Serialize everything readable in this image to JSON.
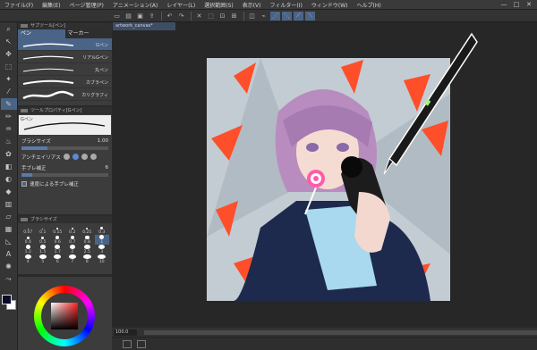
{
  "menu": {
    "items": [
      "ファイル(F)",
      "編集(E)",
      "ページ管理(P)",
      "アニメーション(A)",
      "レイヤー(L)",
      "選択範囲(S)",
      "表示(V)",
      "フィルター(I)",
      "ウィンドウ(W)",
      "ヘルプ(H)"
    ],
    "minimize": "—",
    "maximize": "□",
    "close": "✕"
  },
  "subtool": {
    "header": "サブツール[ペン]",
    "tabs": [
      "ペン",
      "マーカー"
    ],
    "brushes": [
      "Gペン",
      "リアルGペン",
      "丸ペン",
      "カブラペン",
      "カリグラフィ"
    ]
  },
  "toolprop": {
    "header": "ツールプロパティ[Gペン]",
    "brush_name": "Gペン",
    "size_label": "ブラシサイズ",
    "size_value": "1.00",
    "aa_label": "アンチエイリアス",
    "stab_label": "手ブレ補正",
    "stab_value": "6",
    "vector_label": "速度による手ブレ補正"
  },
  "brushsize": {
    "header": "ブラシサイズ",
    "sizes": [
      "0.07",
      "0.1",
      "0.15",
      "0.2",
      "0.25",
      "0.3",
      "0.4",
      "0.5",
      "0.6",
      "0.7",
      "0.8",
      "1",
      "1.2",
      "1.5",
      "1.7",
      "2",
      "2.5",
      "3",
      "4",
      "5",
      "6",
      "7",
      "8",
      "10"
    ]
  },
  "canvas": {
    "tab_title": "artwork_canvas*"
  },
  "status": {
    "zoom": "100.0"
  },
  "colors": {
    "ui_accent": "#4a6488",
    "foreground": "#0b0b2a",
    "background": "#ffffff"
  }
}
